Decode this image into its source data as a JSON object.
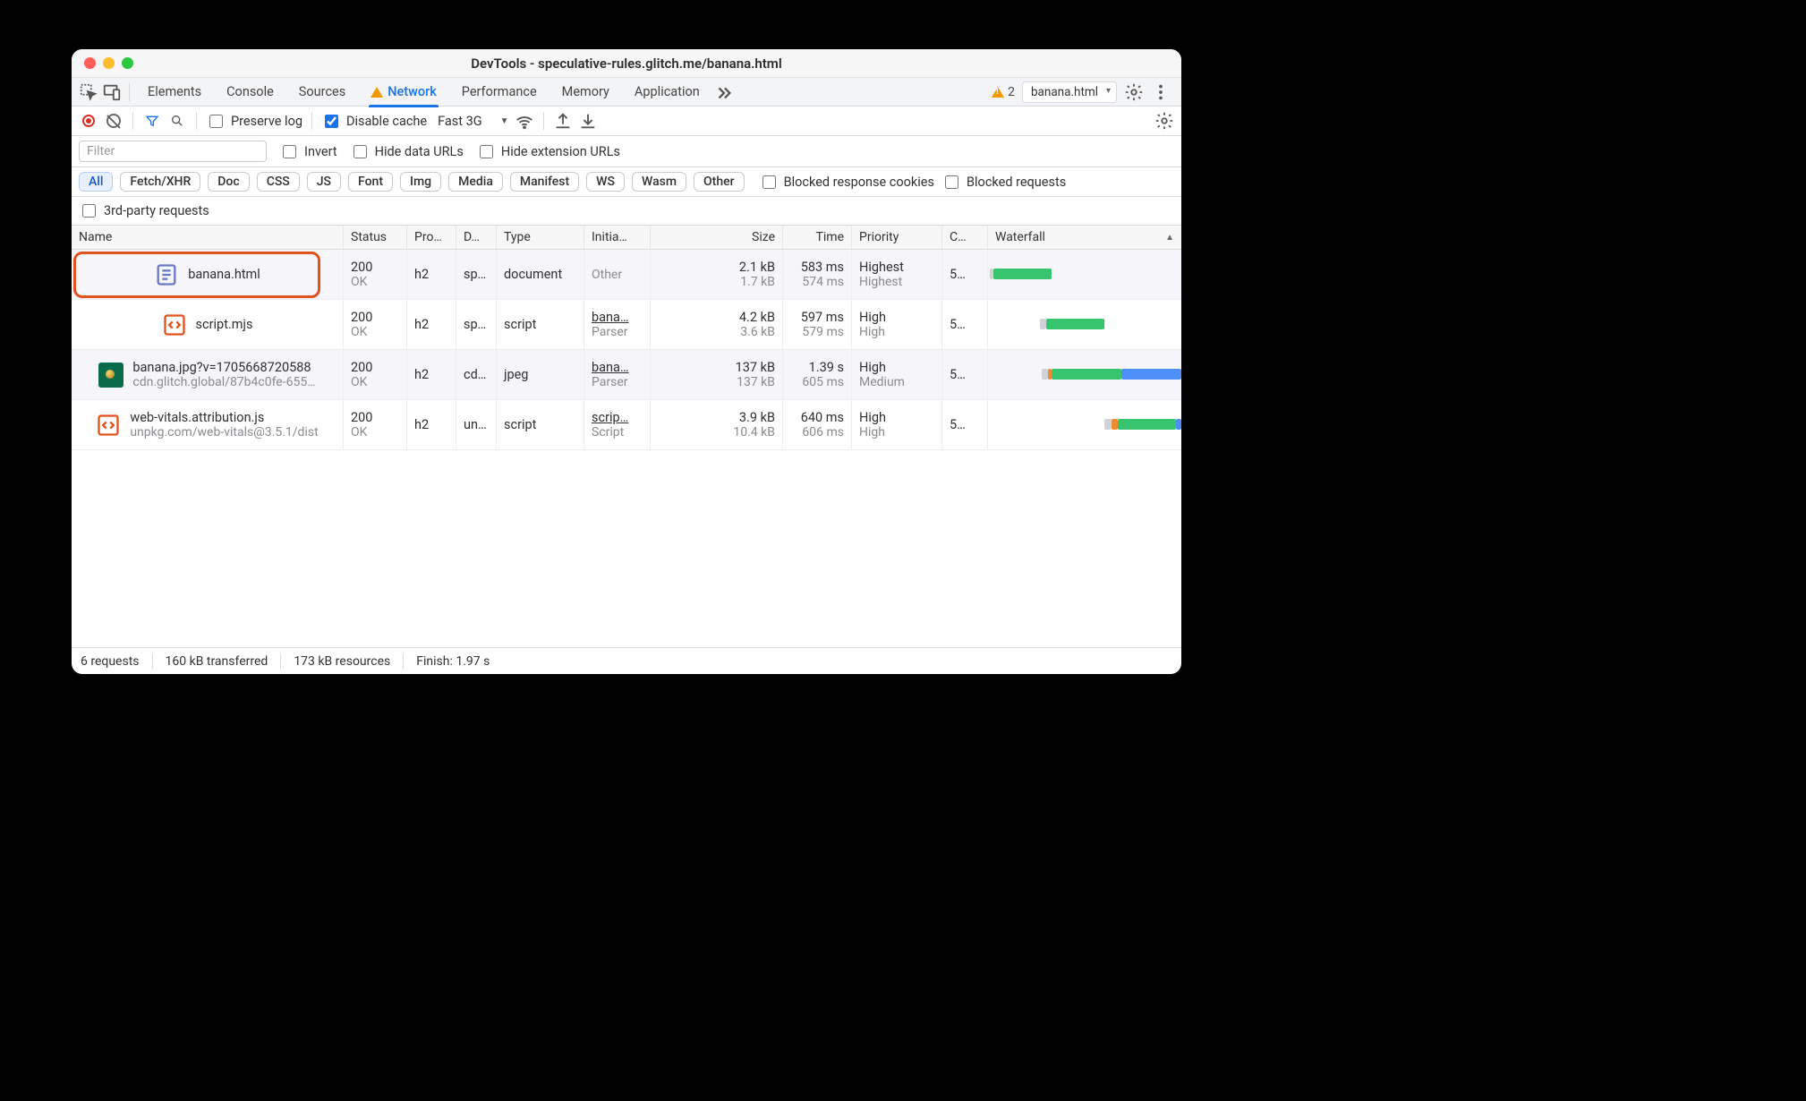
{
  "window": {
    "title": "DevTools - speculative-rules.glitch.me/banana.html"
  },
  "tabs": [
    "Elements",
    "Console",
    "Sources",
    "Network",
    "Performance",
    "Memory",
    "Application"
  ],
  "header": {
    "issues_count": "2",
    "target": "banana.html"
  },
  "toolbar": {
    "preserve_log": "Preserve log",
    "disable_cache": "Disable cache",
    "throttling": "Fast 3G"
  },
  "filter": {
    "placeholder": "Filter",
    "invert": "Invert",
    "hide_data": "Hide data URLs",
    "hide_ext": "Hide extension URLs",
    "blocked_cookies": "Blocked response cookies",
    "blocked_requests": "Blocked requests",
    "third_party": "3rd-party requests"
  },
  "chips": [
    "All",
    "Fetch/XHR",
    "Doc",
    "CSS",
    "JS",
    "Font",
    "Img",
    "Media",
    "Manifest",
    "WS",
    "Wasm",
    "Other"
  ],
  "columns": [
    "Name",
    "Status",
    "Pro…",
    "D…",
    "Type",
    "Initia…",
    "Size",
    "Time",
    "Priority",
    "C…",
    "Waterfall"
  ],
  "rows": [
    {
      "name": "banana.html",
      "status": "200",
      "status_text": "OK",
      "protocol": "h2",
      "domain": "sp…",
      "type": "document",
      "initiator": "Other",
      "size": "2.1 kB",
      "size2": "1.7 kB",
      "time": "583 ms",
      "time2": "574 ms",
      "priority": "Highest",
      "priority2": "Highest",
      "conn": "5…"
    },
    {
      "name": "script.mjs",
      "status": "200",
      "status_text": "OK",
      "protocol": "h2",
      "domain": "sp…",
      "type": "script",
      "initiator": "bana…",
      "initiator2": "Parser",
      "size": "4.2 kB",
      "size2": "3.6 kB",
      "time": "597 ms",
      "time2": "579 ms",
      "priority": "High",
      "priority2": "High",
      "conn": "5…"
    },
    {
      "name": "banana.jpg?v=1705668720588",
      "path": "cdn.glitch.global/87b4c0fe-655…",
      "status": "200",
      "status_text": "OK",
      "protocol": "h2",
      "domain": "cd…",
      "type": "jpeg",
      "initiator": "bana…",
      "initiator2": "Parser",
      "size": "137 kB",
      "size2": "137 kB",
      "time": "1.39 s",
      "time2": "605 ms",
      "priority": "High",
      "priority2": "Medium",
      "conn": "5…"
    },
    {
      "name": "web-vitals.attribution.js",
      "path": "unpkg.com/web-vitals@3.5.1/dist",
      "status": "200",
      "status_text": "OK",
      "protocol": "h2",
      "domain": "un…",
      "type": "script",
      "initiator": "scrip…",
      "initiator2": "Script",
      "size": "3.9 kB",
      "size2": "10.4 kB",
      "time": "640 ms",
      "time2": "606 ms",
      "priority": "High",
      "priority2": "High",
      "conn": "5…"
    }
  ],
  "footer": {
    "requests": "6 requests",
    "transferred": "160 kB transferred",
    "resources": "173 kB resources",
    "finish": "Finish: 1.97 s"
  }
}
